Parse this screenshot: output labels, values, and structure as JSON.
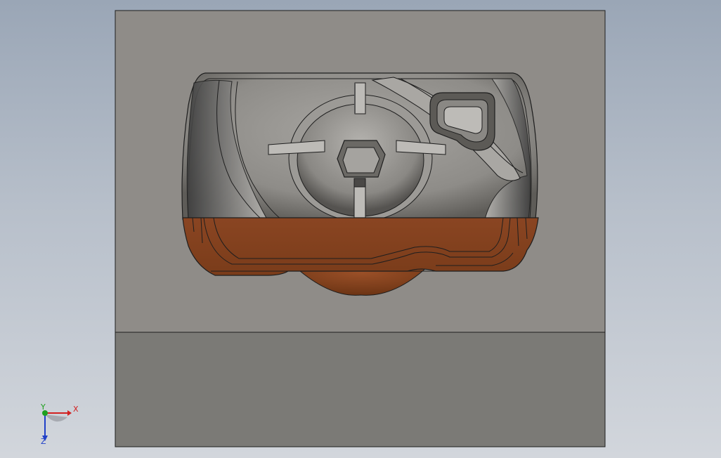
{
  "viewport": {
    "background_top": "#9aa6b6",
    "background_bottom": "#d2d6dc"
  },
  "model": {
    "mold_plate_color": "#8f8c88",
    "base_block_color": "#7b7a76",
    "cavity_color": "#9a9894",
    "part_color": "#84421f",
    "edge_color": "#1e1e1e"
  },
  "triad": {
    "x_label": "X",
    "y_label": "Y",
    "z_label": "Z",
    "x_color": "#d22020",
    "y_color": "#1ea01e",
    "z_color": "#2040c8"
  }
}
